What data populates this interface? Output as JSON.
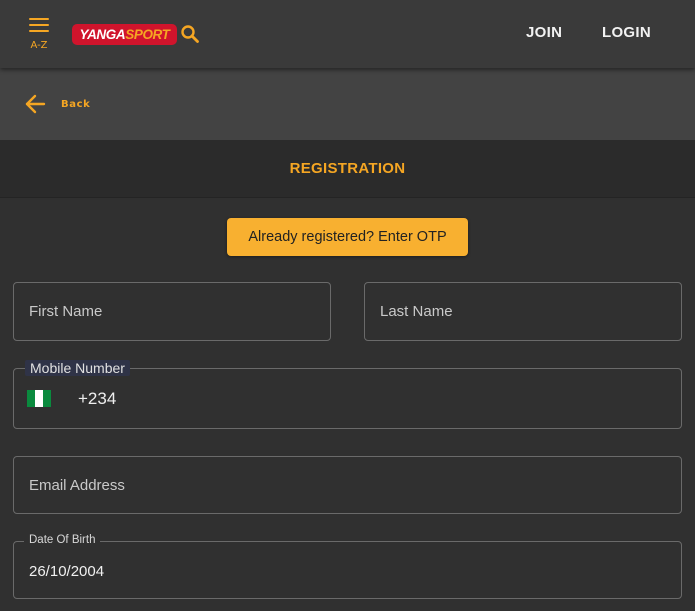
{
  "header": {
    "menu_label": "A-Z",
    "logo": {
      "part1": "YANGA",
      "part2": "SPORT"
    },
    "join": "JOIN",
    "login": "LOGIN"
  },
  "backbar": {
    "label": "Back"
  },
  "registration": {
    "title": "REGISTRATION",
    "otp_button": "Already registered? Enter OTP"
  },
  "form": {
    "first_name": {
      "placeholder": "First Name",
      "value": ""
    },
    "last_name": {
      "placeholder": "Last Name",
      "value": ""
    },
    "mobile": {
      "label": "Mobile Number",
      "dial_code": "+234",
      "flag": "nigeria-flag-icon",
      "value": ""
    },
    "email": {
      "placeholder": "Email Address",
      "value": ""
    },
    "dob": {
      "label": "Date Of Birth",
      "value": "26/10/2004"
    }
  },
  "colors": {
    "accent": "#f5a623",
    "logo_bg": "#d0142c",
    "header_bg": "#3a3a3a",
    "page_bg": "#303030"
  },
  "icons": {
    "menu": "hamburger-menu-icon",
    "search": "search-icon",
    "back": "back-arrow-icon"
  }
}
